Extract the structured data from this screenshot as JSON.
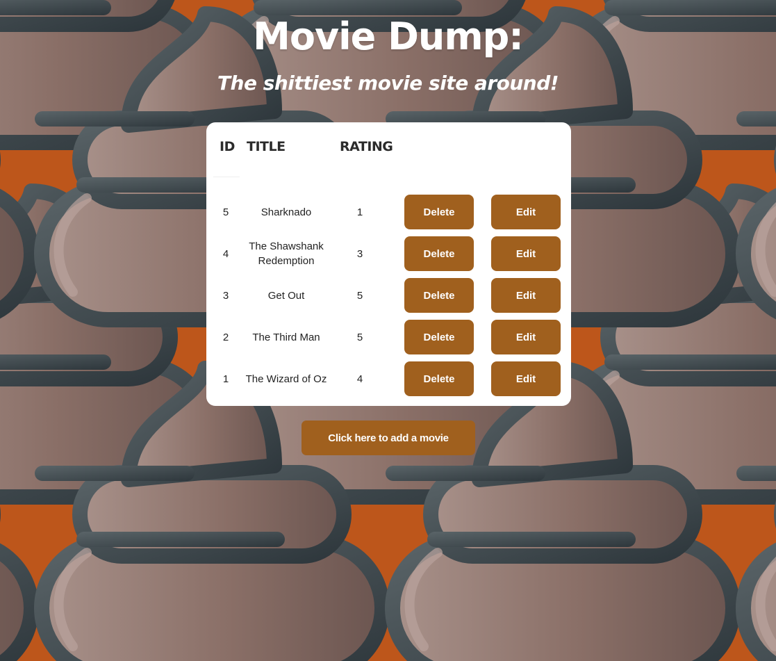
{
  "page": {
    "title": "Movie Dump:",
    "subtitle": "The shittiest movie site around!"
  },
  "table": {
    "headers": {
      "id": "ID",
      "title": "TITLE",
      "rating": "RATING"
    },
    "rows": [
      {
        "id": "5",
        "title": "Sharknado",
        "rating": "1",
        "delete_label": "Delete",
        "edit_label": "Edit"
      },
      {
        "id": "4",
        "title": "The Shawshank Redemption",
        "rating": "3",
        "delete_label": "Delete",
        "edit_label": "Edit"
      },
      {
        "id": "3",
        "title": "Get Out",
        "rating": "5",
        "delete_label": "Delete",
        "edit_label": "Edit"
      },
      {
        "id": "2",
        "title": "The Third Man",
        "rating": "5",
        "delete_label": "Delete",
        "edit_label": "Edit"
      },
      {
        "id": "1",
        "title": "The Wizard of Oz",
        "rating": "4",
        "delete_label": "Delete",
        "edit_label": "Edit"
      }
    ]
  },
  "add_button_label": "Click here to add a movie",
  "colors": {
    "background": "#bd561b",
    "button": "#a0601e",
    "card": "#ffffff",
    "pattern_fill": "#8a6a62",
    "pattern_outline": "#3a4348"
  },
  "background_pattern_icon": "poop-icon"
}
